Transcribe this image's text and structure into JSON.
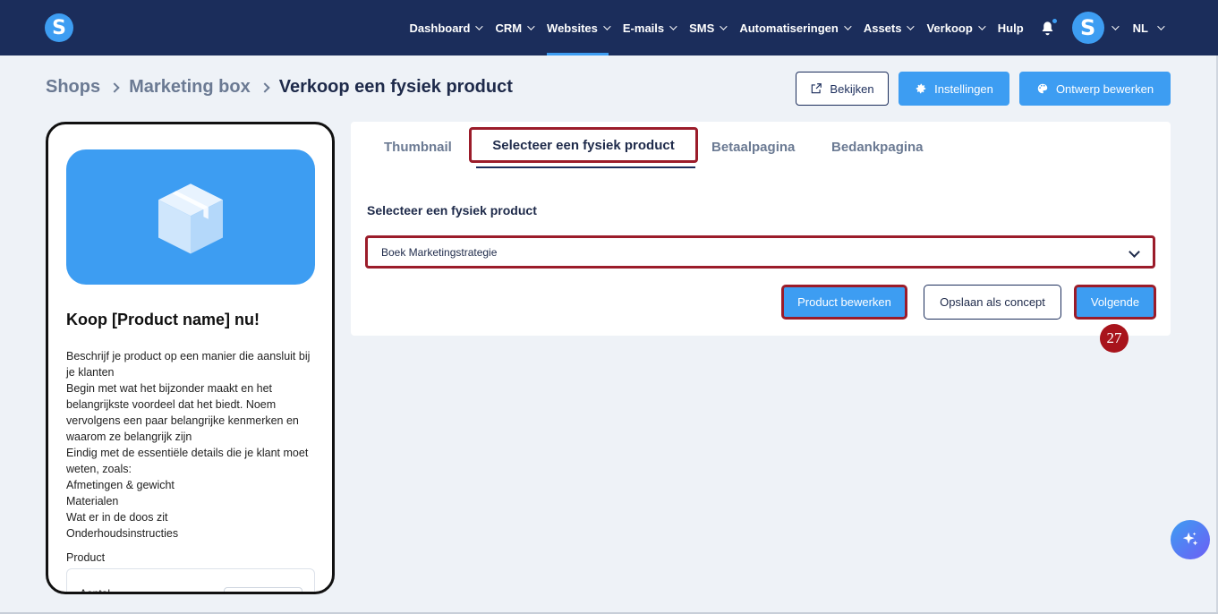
{
  "nav": {
    "items": [
      {
        "label": "Dashboard",
        "has_menu": true
      },
      {
        "label": "CRM",
        "has_menu": true
      },
      {
        "label": "Websites",
        "has_menu": true,
        "active": true
      },
      {
        "label": "E-mails",
        "has_menu": true
      },
      {
        "label": "SMS",
        "has_menu": true
      },
      {
        "label": "Automatiseringen",
        "has_menu": true
      },
      {
        "label": "Assets",
        "has_menu": true
      },
      {
        "label": "Verkoop",
        "has_menu": true
      },
      {
        "label": "Hulp",
        "has_menu": false
      }
    ],
    "logo_letter": "S",
    "avatar_letter": "S",
    "language": "NL"
  },
  "breadcrumb": {
    "items": [
      "Shops",
      "Marketing box",
      "Verkoop een fysiek product"
    ]
  },
  "header_actions": {
    "view_label": "Bekijken",
    "settings_label": "Instellingen",
    "design_label": "Ontwerp bewerken"
  },
  "preview": {
    "title": "Koop [Product name] nu!",
    "description_lines": [
      "Beschrijf je product op een manier die aansluit bij je klanten",
      "Begin met wat het bijzonder maakt en het belangrijkste voordeel dat het biedt. Noem vervolgens een paar belangrijke kenmerken en waarom ze belangrijk zijn",
      "Eindig met de essentiële details die je klant moet weten, zoals:",
      "Afmetingen & gewicht",
      "Materialen",
      "Wat er in de doos zit",
      "Onderhoudsinstructies"
    ],
    "product_label": "Product",
    "quantity_label": "Aantal"
  },
  "tabs": {
    "thumbnail": "Thumbnail",
    "select_product": "Selecteer een fysiek product",
    "payment_page": "Betaalpagina",
    "thanks_page": "Bedankpagina"
  },
  "form": {
    "label": "Selecteer een fysiek product",
    "selected_value": "Boek Marketingstrategie"
  },
  "actions": {
    "edit_product": "Product bewerken",
    "save_draft": "Opslaan als concept",
    "next": "Volgende"
  },
  "step_badge": "27",
  "colors": {
    "nav_bg": "#1b2d5b",
    "accent": "#3d9df2",
    "highlight": "#9b1c2a",
    "badge": "#a8141c",
    "page_bg": "#eef2f7"
  }
}
